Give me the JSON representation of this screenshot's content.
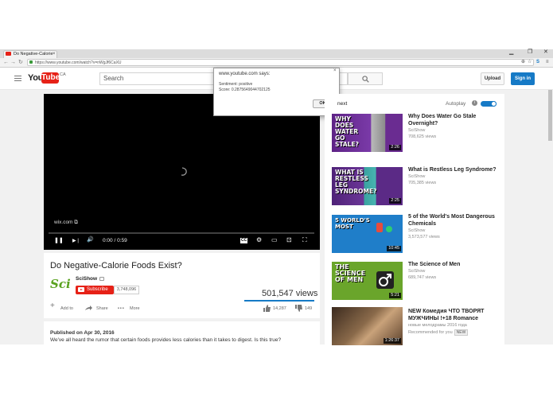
{
  "browser": {
    "tab_title": "Do Negative-Calorie",
    "tab_close": "×",
    "url": "https://www.youtube.com/watch?v=nWgJf6CaXU",
    "win_min": "▁",
    "win_max": "❐",
    "win_close": "✕",
    "back": "←",
    "forward": "→",
    "reload": "↻",
    "zoom_icon": "⊕",
    "star_icon": "☆",
    "ext_icon": "S",
    "menu_icon": "≡"
  },
  "header": {
    "logo_you": "You",
    "logo_tube": "Tube",
    "logo_region": "CA",
    "search_placeholder": "Search",
    "upload_label": "Upload",
    "signin_label": "Sign in"
  },
  "player": {
    "watermark": "wix.com ⧉",
    "play_icon": "❚❚",
    "next_icon": "▶❘",
    "volume_icon": "🔊",
    "time": "0:00 / 0:59",
    "cc_icon": "CC",
    "settings_icon": "⚙",
    "theater_icon": "▭",
    "cast_icon": "⊡",
    "fullscreen_icon": "⛶"
  },
  "dialog": {
    "title": "www.youtube.com says:",
    "line1": "Sentiment: positive",
    "line2": "Score: 0.2875649044702125",
    "ok_label": "OK",
    "close": "×"
  },
  "video": {
    "title": "Do Negative-Calorie Foods Exist?",
    "channel_logo": "Sci",
    "channel_name": "SciShow",
    "subscribe_label": "Subscribe",
    "subscriber_count": "3,748,096",
    "views": "501,547 views",
    "add_to": "Add to",
    "share": "Share",
    "more": "More",
    "likes": "14,287",
    "dislikes": "149",
    "published": "Published on Apr 30, 2016",
    "description": "We've all heard the rumor that certain foods provides less calories than it takes to digest. Is this true?"
  },
  "sidebar": {
    "up_next": "next",
    "autoplay": "Autoplay",
    "info": "i",
    "items": [
      {
        "thumb_text": "WHY DOES WATER GO STALE?",
        "duration": "2:26",
        "title": "Why Does Water Go Stale Overnight?",
        "channel": "SciShow",
        "views": "708,625 views",
        "color": "#6a2c91"
      },
      {
        "thumb_text": "WHAT IS RESTLESS LEG SYNDROME?",
        "duration": "2:25",
        "title": "What is Restless Leg Syndrome?",
        "channel": "SciShow",
        "views": "705,385 views",
        "color": "#5b2a86"
      },
      {
        "thumb_text": "5 WORLD'S MOST",
        "duration": "10:45",
        "title": "5 of the World's Most Dangerous Chemicals",
        "channel": "SciShow",
        "views": "3,573,577 views",
        "color": "#1f7ec9"
      },
      {
        "thumb_text": "THE SCIENCE OF MEN",
        "duration": "5:21",
        "title": "The Science of Men",
        "channel": "SciShow",
        "views": "689,747 views",
        "color": "#6aa52b"
      },
      {
        "thumb_text": "",
        "duration": "1:26:37",
        "title": "NEW Комедия ЧТО ТВОРЯТ МУЖЧИНЫ !+18 Romance",
        "channel": "новые мелодрамы 2016 года",
        "views": "Recommended for you",
        "badge": "NEW",
        "color": "#8a6a4a"
      }
    ]
  }
}
